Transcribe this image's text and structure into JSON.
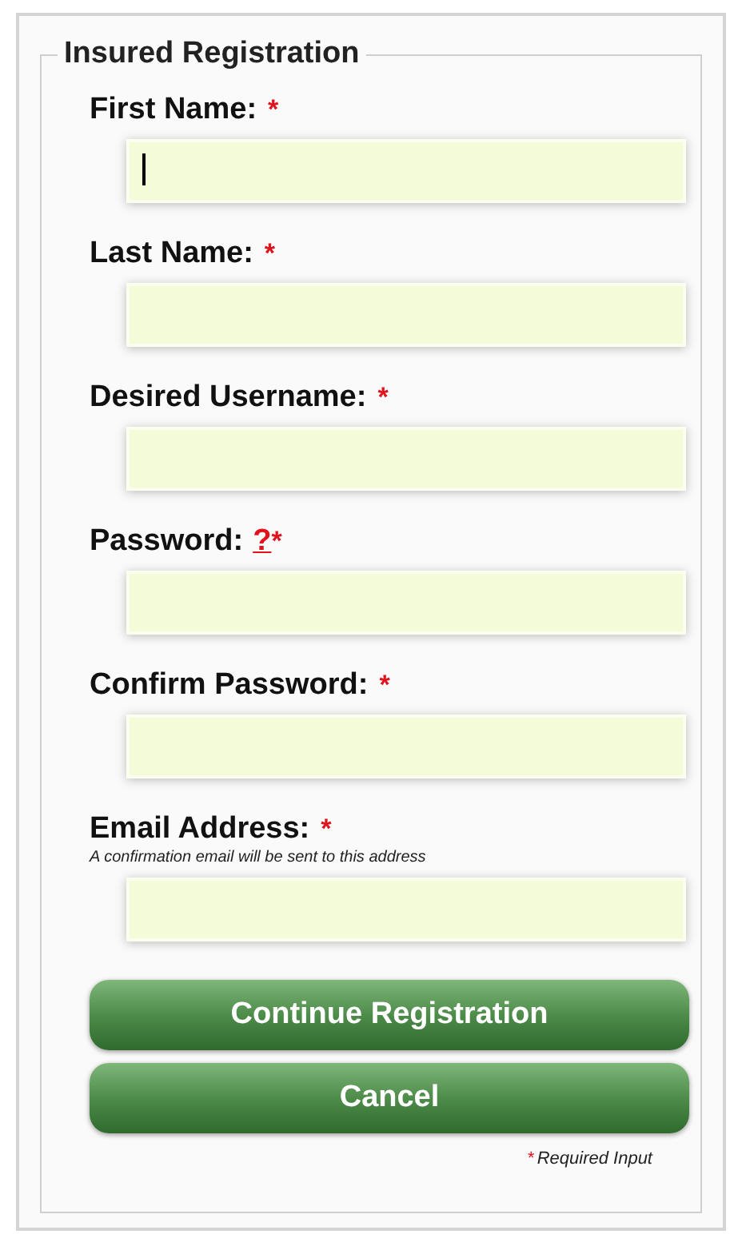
{
  "legend": "Insured Registration",
  "fields": [
    {
      "label": "First Name:",
      "required_mark": "*",
      "focused": true
    },
    {
      "label": "Last Name:",
      "required_mark": "*",
      "focused": false
    },
    {
      "label": "Desired Username:",
      "required_mark": "*",
      "focused": false
    },
    {
      "label": "Password:",
      "help": "?",
      "required_mark": "*",
      "focused": false
    },
    {
      "label": "Confirm Password:",
      "required_mark": "*",
      "focused": false
    },
    {
      "label": "Email Address:",
      "required_mark": "*",
      "note": "A confirmation email will be sent to this address",
      "focused": false
    }
  ],
  "buttons": [
    "Continue Registration",
    "Cancel"
  ],
  "footnote": {
    "mark": "*",
    "text": "Required Input"
  }
}
